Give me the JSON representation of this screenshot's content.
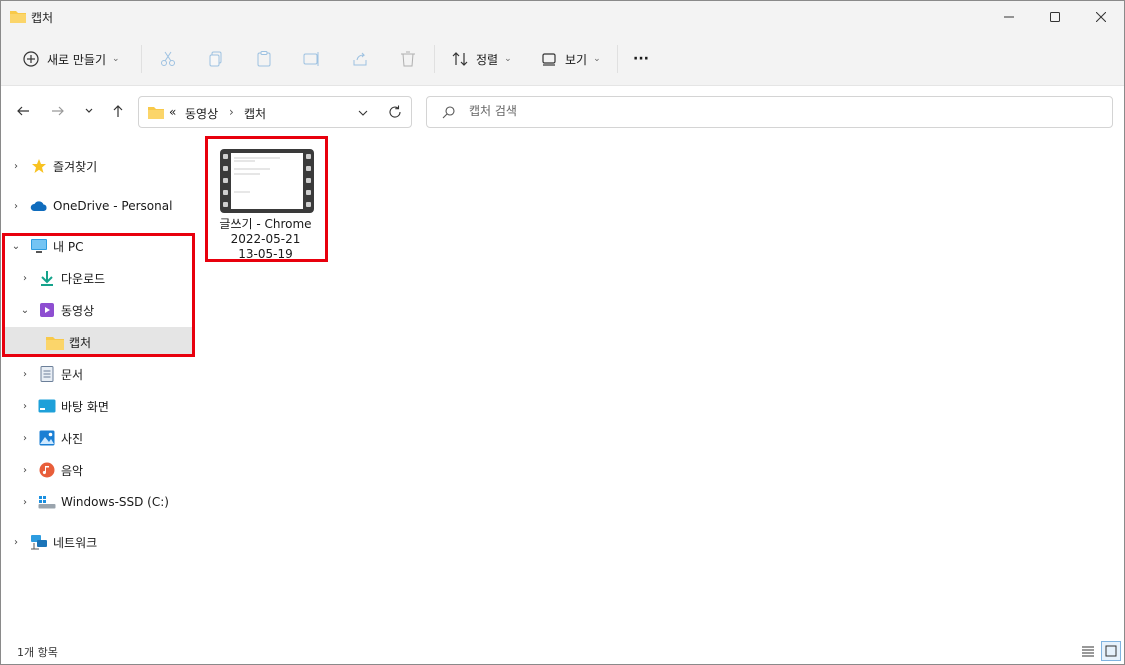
{
  "window": {
    "title": "캡처"
  },
  "toolbar": {
    "new_label": "새로 만들기",
    "sort_label": "정렬",
    "view_label": "보기",
    "more_label": "···"
  },
  "address": {
    "overflow": "«",
    "crumbs": [
      "동영상",
      "캡처"
    ]
  },
  "search": {
    "placeholder": "캡처 검색"
  },
  "sidebar": {
    "items": [
      {
        "label": "즐겨찾기",
        "icon": "star-icon"
      },
      {
        "label": "OneDrive - Personal",
        "icon": "cloud-icon"
      },
      {
        "label": "내 PC",
        "icon": "monitor-icon"
      },
      {
        "label": "다운로드",
        "icon": "download-icon"
      },
      {
        "label": "동영상",
        "icon": "video-icon"
      },
      {
        "label": "캡처",
        "icon": "folder-icon"
      },
      {
        "label": "문서",
        "icon": "document-icon"
      },
      {
        "label": "바탕 화면",
        "icon": "desktop-icon"
      },
      {
        "label": "사진",
        "icon": "picture-icon"
      },
      {
        "label": "음악",
        "icon": "music-icon"
      },
      {
        "label": "Windows-SSD (C:)",
        "icon": "drive-icon"
      },
      {
        "label": "네트워크",
        "icon": "network-icon"
      }
    ]
  },
  "files": [
    {
      "line1": "글쓰기 - Chrome",
      "line2": "2022-05-21",
      "line3": "13-05-19",
      "icon": "video-file-icon"
    }
  ],
  "status": {
    "count": "1개 항목"
  },
  "colors": {
    "highlight": "#e8000d",
    "folder": "#f8c94a",
    "accent": "#0067c0"
  }
}
